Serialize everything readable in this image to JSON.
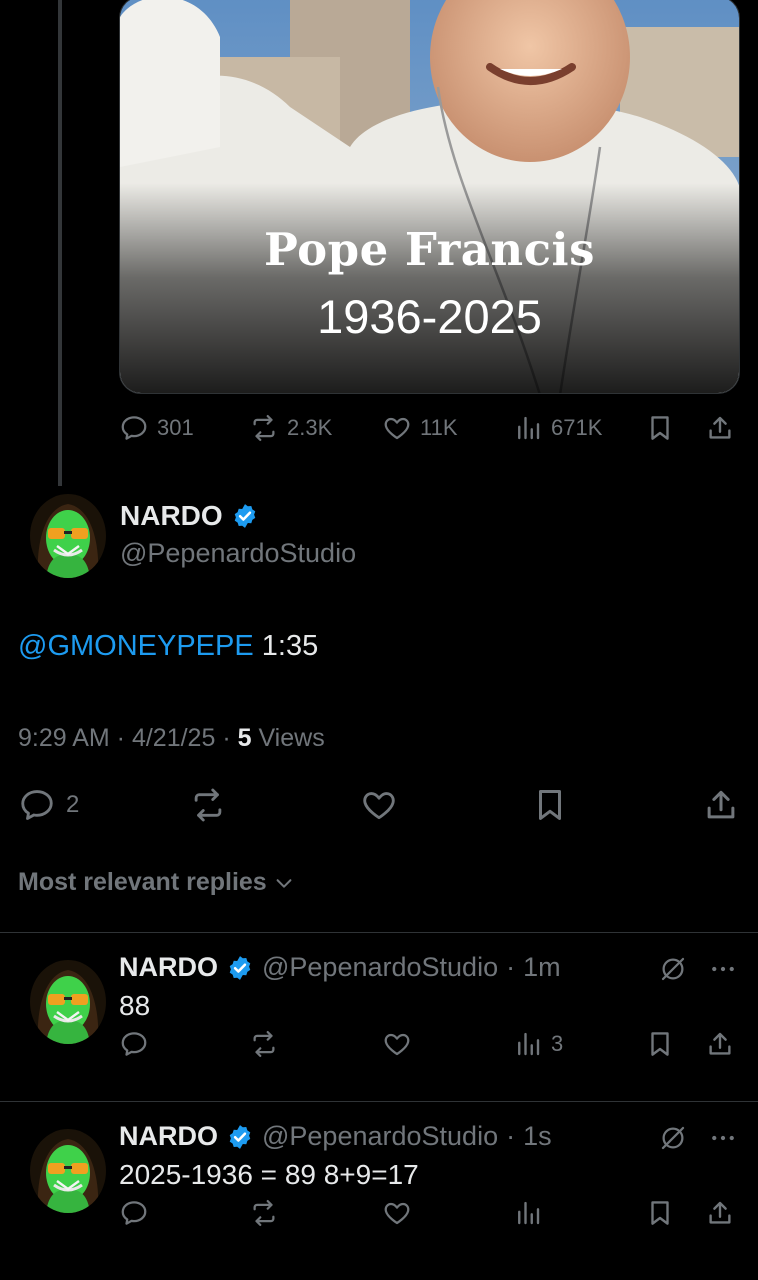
{
  "quoted_post": {
    "media_title": "Pope Francis",
    "media_years": "1936-2025",
    "stats": {
      "replies": "301",
      "reposts": "2.3K",
      "likes": "11K",
      "views": "671K"
    }
  },
  "main_post": {
    "author_name": "NARDO",
    "author_handle": "@PepenardoStudio",
    "mention": "@GMONEYPEPE",
    "text_rest": " 1:35",
    "time": "9:29 AM",
    "date": "4/21/25",
    "views_count": "5",
    "views_label": "Views",
    "reply_count": "2"
  },
  "sort_label": "Most relevant replies",
  "replies": [
    {
      "name": "NARDO",
      "handle": "@PepenardoStudio",
      "time": "1m",
      "text": "88",
      "views": "3"
    },
    {
      "name": "NARDO",
      "handle": "@PepenardoStudio",
      "time": "1s",
      "text": "2025-1936 = 89 8+9=17",
      "views": ""
    }
  ],
  "colors": {
    "background": "#000000",
    "accent": "#1d9bf0",
    "muted": "#71767b",
    "text": "#e7e9ea"
  }
}
